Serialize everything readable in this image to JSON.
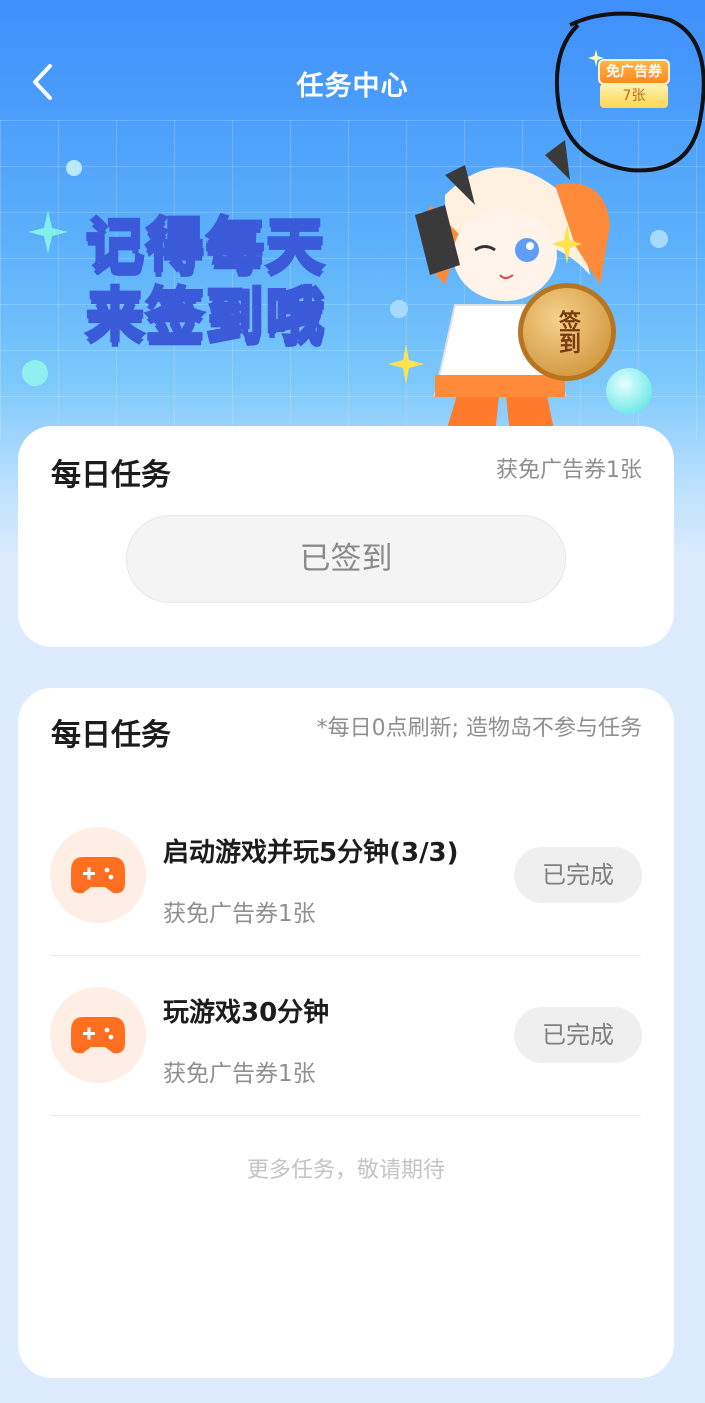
{
  "header": {
    "title": "任务中心",
    "coupon_badge": {
      "label": "免广告券",
      "count": "7张"
    }
  },
  "banner": {
    "line1": "记得每天",
    "line2_prefix": "来",
    "line2_highlight": "签到",
    "line2_suffix": "哦",
    "coin_label": "签到"
  },
  "checkin_card": {
    "title": "每日任务",
    "reward_note": "获免广告券1张",
    "button_label": "已签到"
  },
  "tasks_card": {
    "title": "每日任务",
    "note": "*每日0点刷新; 造物岛不参与任务",
    "tasks": [
      {
        "name": "启动游戏并玩5分钟(3/3)",
        "reward": "获免广告券1张",
        "status": "已完成",
        "icon": "gamepad-icon"
      },
      {
        "name": "玩游戏30分钟",
        "reward": "获免广告券1张",
        "status": "已完成",
        "icon": "gamepad-icon"
      }
    ],
    "footer_tip": "更多任务，敬请期待"
  },
  "colors": {
    "header_blue": "#3f8ffb",
    "icon_orange": "#ff6f1f",
    "icon_bg": "#ffeee6",
    "card_bg": "#ffffff",
    "page_bg": "#dcecfe"
  }
}
